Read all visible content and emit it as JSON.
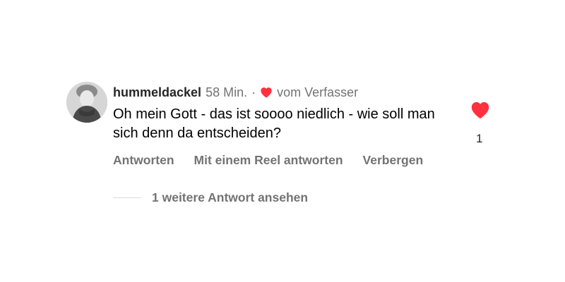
{
  "comment": {
    "username": "hummeldackel",
    "time": "58 Min.",
    "separator": "·",
    "author_like_label": "vom Verfasser",
    "text": "Oh mein Gott - das ist soooo niedlich - wie soll man sich denn da entscheiden?",
    "like_count": "1",
    "like_icon": "heart-filled-icon",
    "accent_color": "#ff3040",
    "secondary_text_color": "#737373"
  },
  "actions": {
    "reply": "Antworten",
    "reel_reply": "Mit einem Reel antworten",
    "hide": "Verbergen"
  },
  "replies": {
    "view_more": "1 weitere Antwort ansehen"
  }
}
